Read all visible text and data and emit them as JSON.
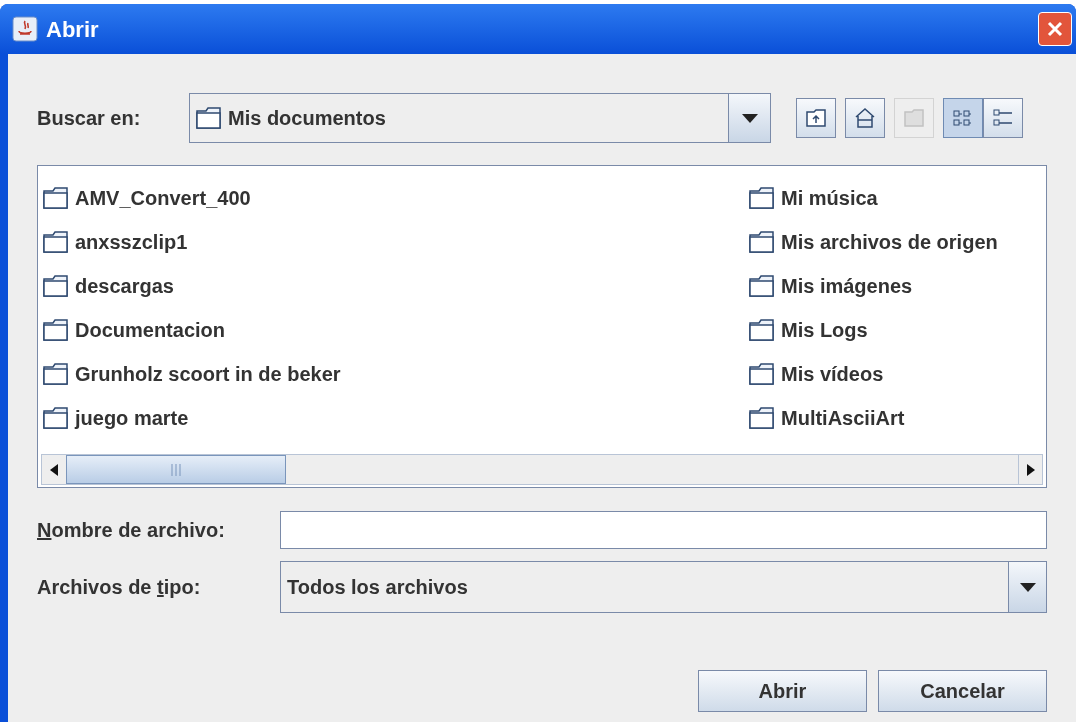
{
  "window": {
    "title": "Abrir"
  },
  "look_in": {
    "label": "Buscar en:",
    "value": "Mis documentos"
  },
  "toolbar": [
    {
      "kind": "up",
      "disabled": false,
      "selected": false
    },
    {
      "kind": "home",
      "disabled": false,
      "selected": false
    },
    {
      "kind": "new-folder",
      "disabled": true,
      "selected": false
    },
    {
      "kind": "list",
      "disabled": false,
      "selected": true
    },
    {
      "kind": "details",
      "disabled": false,
      "selected": false
    }
  ],
  "files": {
    "columns": [
      [
        "AMV_Convert_400",
        "anxsszclip1",
        "descargas",
        "Documentacion",
        "Grunholz scoort in de beker",
        "juego marte"
      ],
      [
        "Mi música",
        "Mis archivos de origen",
        "Mis imágenes",
        "Mis Logs",
        "Mis vídeos",
        "MultiAsciiArt"
      ]
    ]
  },
  "file_name": {
    "label": {
      "key": "N",
      "after": "ombre de archivo:"
    }
  },
  "file_type": {
    "label": {
      "before": "Archivos de ",
      "key": "t",
      "after": "ipo:"
    },
    "value": "Todos los archivos"
  },
  "buttons": [
    "Abrir",
    "Cancelar"
  ]
}
